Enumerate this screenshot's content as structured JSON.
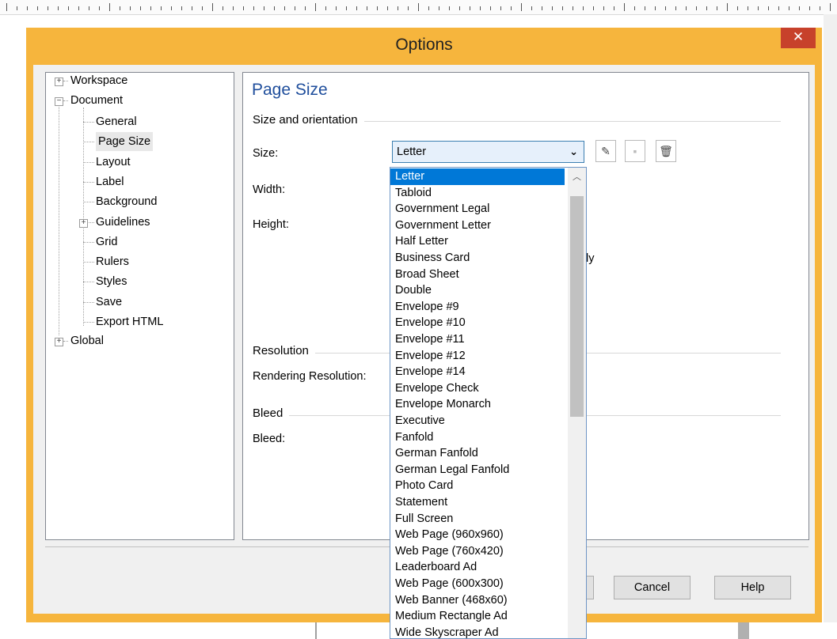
{
  "dialog": {
    "title": "Options",
    "close_label": "✕"
  },
  "tree": {
    "workspace": "Workspace",
    "document": "Document",
    "global": "Global",
    "children": [
      "General",
      "Page Size",
      "Layout",
      "Label",
      "Background",
      "Guidelines",
      "Grid",
      "Rulers",
      "Styles",
      "Save",
      "Export HTML"
    ],
    "selected": "Page Size"
  },
  "panel": {
    "title": "Page Size",
    "size_orientation": "Size and orientation",
    "size_label": "Size:",
    "width_label": "Width:",
    "height_label": "Height:",
    "resolution": "Resolution",
    "rendering_resolution_label": "Rendering Resolution:",
    "bleed": "Bleed",
    "bleed_label": "Bleed:",
    "partial_text": "ly"
  },
  "size_select": {
    "value": "Letter"
  },
  "dropdown": {
    "items": [
      "Letter",
      "Tabloid",
      "Government Legal",
      "Government Letter",
      "Half Letter",
      "Business Card",
      "Broad Sheet",
      "Double",
      "Envelope #9",
      "Envelope #10",
      "Envelope #11",
      "Envelope #12",
      "Envelope #14",
      "Envelope Check",
      "Envelope Monarch",
      "Executive",
      "Fanfold",
      "German Fanfold",
      "German Legal Fanfold",
      "Photo Card",
      "Statement",
      "Full Screen",
      "Web Page (960x960)",
      "Web Page (760x420)",
      "Leaderboard Ad",
      "Web Page (600x300)",
      "Web Banner (468x60)",
      "Medium Rectangle Ad",
      "Wide Skyscraper Ad"
    ],
    "selected_index": 0
  },
  "buttons": {
    "cancel": "Cancel",
    "help": "Help"
  },
  "colors": {
    "titlebar": "#f6b53d",
    "close": "#c7412b",
    "selection": "#0078d7",
    "heading": "#1f4e9c"
  }
}
